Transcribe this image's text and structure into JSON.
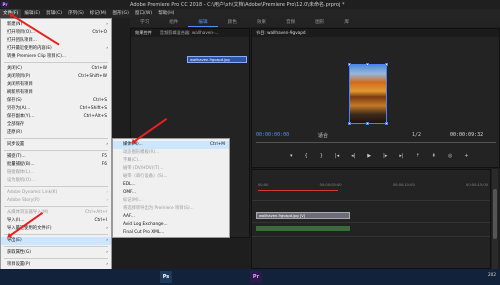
{
  "window": {
    "title": "Adobe Premiere Pro CC 2018 - C:\\用户\\xh\\文档\\Adobe\\Premiere Pro\\12.0\\未命名.prproj *",
    "app_icon": "Pr"
  },
  "menubar": [
    "文件(F)",
    "编辑(E)",
    "剪辑(C)",
    "序列(S)",
    "标记(M)",
    "图形(G)",
    "窗口(W)",
    "帮助(H)"
  ],
  "workspace_tabs": [
    "学习",
    "组件",
    "编辑",
    "颜色",
    "效果",
    "音频",
    "图形",
    "库"
  ],
  "source_panel": {
    "tabs": [
      "效果控件",
      "音频剪辑混合器: wallhaven-..."
    ],
    "clip_label": "wallhaven-9gvapd.jpg"
  },
  "program_panel": {
    "tab": "节目: wallhaven-9gvapd",
    "timecode_left": "00:00:00:00",
    "timecode_right": "00:00:09:32",
    "fit_label": "适合",
    "ratio": "1/2"
  },
  "timeline": {
    "ruler": [
      "00:00",
      "00:00:05:00",
      "00:00:10:00",
      "00:00:15:00"
    ],
    "clip_label": "wallhaven-9gvapd.jpg [V]",
    "clip_label2": "fx"
  },
  "file_menu": [
    {
      "label": "新建(N)",
      "shortcut": "",
      "arrow": true,
      "disabled": false
    },
    {
      "label": "打开项目(O)...",
      "shortcut": "Ctrl+O",
      "disabled": false
    },
    {
      "label": "打开团队项目...",
      "shortcut": "",
      "disabled": false
    },
    {
      "label": "打开最近使用的内容(E)",
      "shortcut": "",
      "arrow": true,
      "disabled": false
    },
    {
      "label": "转换 Premiere Clip 项目(C)...",
      "shortcut": "",
      "disabled": false
    },
    {
      "label": "关闭(C)",
      "shortcut": "Ctrl+W",
      "disabled": false
    },
    {
      "label": "关闭项目(P)",
      "shortcut": "Ctrl+Shift+W",
      "disabled": false
    },
    {
      "label": "关闭所有项目",
      "shortcut": "",
      "disabled": false
    },
    {
      "label": "刷新所有项目",
      "shortcut": "",
      "disabled": false
    },
    {
      "label": "保存(S)",
      "shortcut": "Ctrl+S",
      "disabled": false
    },
    {
      "label": "另存为(A)...",
      "shortcut": "Ctrl+Shift+S",
      "disabled": false
    },
    {
      "label": "保存副本(Y)...",
      "shortcut": "Ctrl+Alt+S",
      "disabled": false
    },
    {
      "label": "全部保存",
      "shortcut": "",
      "disabled": false
    },
    {
      "label": "还原(R)",
      "shortcut": "",
      "disabled": false
    },
    {
      "label": "同步设置",
      "shortcut": "",
      "arrow": true,
      "disabled": false
    },
    {
      "label": "捕捉(T)...",
      "shortcut": "F5",
      "disabled": false
    },
    {
      "label": "批量捕捉(B)...",
      "shortcut": "F6",
      "disabled": false
    },
    {
      "label": "链接媒体(L)...",
      "shortcut": "",
      "disabled": true
    },
    {
      "label": "设为脱机(O)...",
      "shortcut": "",
      "disabled": true
    },
    {
      "label": "Adobe Dynamic Link(K)",
      "shortcut": "",
      "arrow": true,
      "disabled": true
    },
    {
      "label": "Adobe Story(R)",
      "shortcut": "",
      "arrow": true,
      "disabled": true
    },
    {
      "label": "从媒体浏览器导入(M)",
      "shortcut": "Ctrl+Alt+I",
      "disabled": true
    },
    {
      "label": "导入(I)...",
      "shortcut": "Ctrl+I",
      "disabled": false
    },
    {
      "label": "导入最近使用的文件(F)",
      "shortcut": "",
      "arrow": true,
      "disabled": false
    },
    {
      "label": "导出(E)",
      "shortcut": "",
      "arrow": true,
      "disabled": false
    },
    {
      "label": "获取属性(G)",
      "shortcut": "",
      "arrow": true,
      "disabled": false
    },
    {
      "label": "项目设置(P)",
      "shortcut": "",
      "arrow": true,
      "disabled": false
    },
    {
      "label": "项目管理(M)...",
      "shortcut": "",
      "disabled": false
    },
    {
      "label": "退出(X)",
      "shortcut": "Ctrl+Q",
      "disabled": false
    }
  ],
  "export_submenu": [
    {
      "label": "媒体(M)...",
      "shortcut": "Ctrl+M",
      "disabled": false
    },
    {
      "label": "动态图形模板(R)...",
      "shortcut": "",
      "disabled": true
    },
    {
      "label": "字幕(C)...",
      "shortcut": "",
      "disabled": true
    },
    {
      "label": "磁带 (DV/HDV)(T)...",
      "shortcut": "",
      "disabled": true
    },
    {
      "label": "磁带（串行设备）(S)...",
      "shortcut": "",
      "disabled": true
    },
    {
      "label": "EDL...",
      "shortcut": "",
      "disabled": false
    },
    {
      "label": "OMF...",
      "shortcut": "",
      "disabled": false
    },
    {
      "label": "标记(M)...",
      "shortcut": "",
      "disabled": true
    },
    {
      "label": "将选择项导出为 Premiere 项目(S)...",
      "shortcut": "",
      "disabled": true
    },
    {
      "label": "AAF...",
      "shortcut": "",
      "disabled": false
    },
    {
      "label": "Avid Log Exchange...",
      "shortcut": "",
      "disabled": false
    },
    {
      "label": "Final Cut Pro XML...",
      "shortcut": "",
      "disabled": false
    }
  ],
  "taskbar": {
    "clock": "202",
    "apps": [
      "Ps",
      "Pr"
    ]
  },
  "colors": {
    "accent": "#4f8ff7",
    "annotation": "#e8201e",
    "menu_bg": "#f0f0f0"
  }
}
